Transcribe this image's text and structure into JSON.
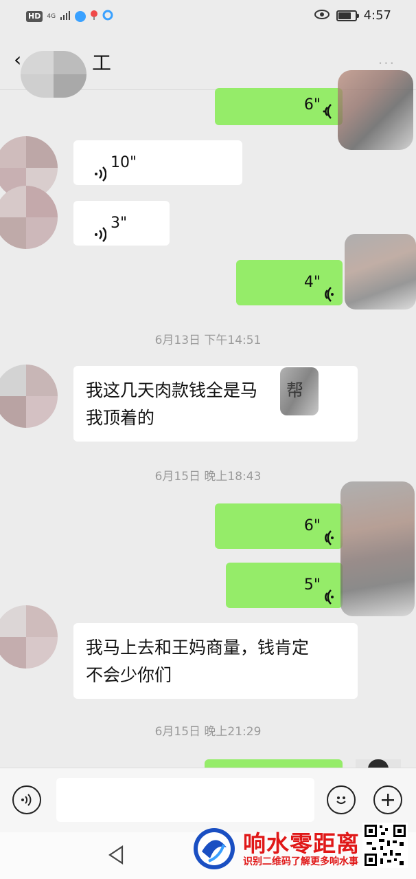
{
  "status_bar": {
    "hd": "HD",
    "net": "4G",
    "time": "4:57"
  },
  "header": {
    "title_visible": "工",
    "back_label": "‹",
    "more_label": "···"
  },
  "messages": [
    {
      "side": "me",
      "duration": "6\""
    },
    {
      "side": "other",
      "duration": "10\""
    },
    {
      "side": "other",
      "duration": "3\""
    },
    {
      "side": "me",
      "duration": "4\""
    },
    {
      "timestamp": "6月13日 下午14:51"
    },
    {
      "side": "other",
      "text_line1": "我这几天肉款钱全是马",
      "text_line1b": "帮",
      "text_line2": "我顶着的"
    },
    {
      "timestamp": "6月15日 晚上18:43"
    },
    {
      "side": "me",
      "duration": "6\""
    },
    {
      "side": "me",
      "duration": "5\""
    },
    {
      "side": "other",
      "text_line1": "我马上去和王妈商量，钱肯定",
      "text_line2": "不会少你们"
    },
    {
      "timestamp": "6月15日 晚上21:29"
    }
  ],
  "watermark": {
    "title": "响水零距离",
    "subtitle": "识别二维码了解更多响水事"
  },
  "colors": {
    "my_bubble": "#95ec69",
    "other_bubble": "#ffffff",
    "background": "#ececec",
    "watermark_red": "#e01818"
  },
  "icons": [
    "voice-input-icon",
    "emoji-icon",
    "plus-icon",
    "nav-back-icon",
    "wifi-voice-icon",
    "eye-icon",
    "battery-icon"
  ]
}
